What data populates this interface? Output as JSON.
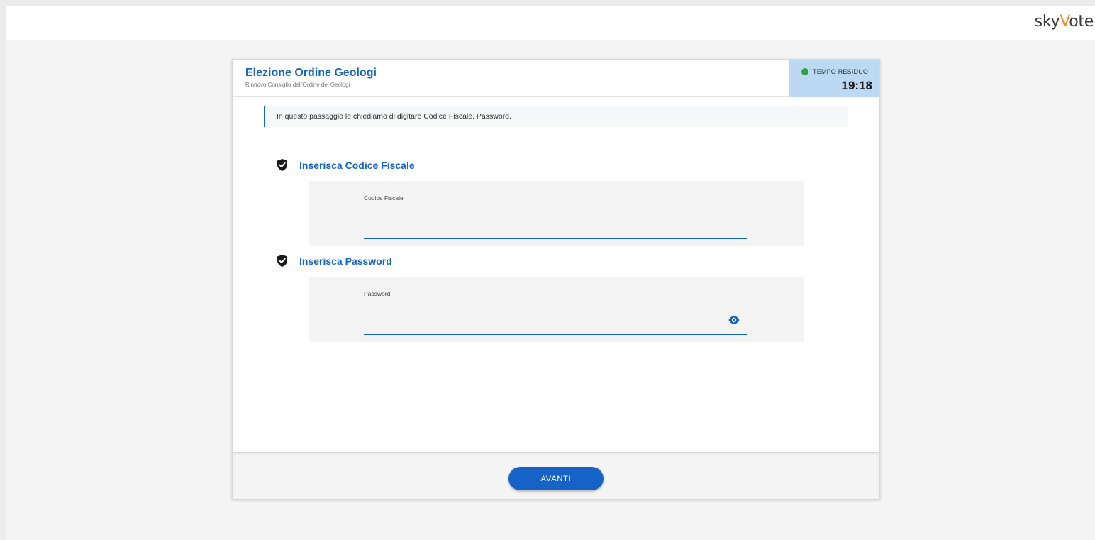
{
  "brand": {
    "part1": "sky",
    "part2": "V",
    "part3": "ote"
  },
  "header": {
    "title": "Elezione Ordine Geologi",
    "subtitle": "Rinnovo Consiglio dell'Ordine dei Geologi"
  },
  "timer": {
    "label": "TEMPO RESIDUO",
    "value": "19:18",
    "status_color": "#2ea043"
  },
  "info": {
    "text": "In questo passaggio le chiediamo di digitare Codice Fiscale, Password."
  },
  "sections": {
    "codice_fiscale": {
      "title": "Inserisca Codice Fiscale",
      "label": "Codice Fiscale",
      "value": "",
      "icon": "shield-check-icon"
    },
    "password": {
      "title": "Inserisca Password",
      "label": "Password",
      "value": "",
      "icon": "shield-check-icon",
      "toggle_icon": "eye-icon"
    }
  },
  "footer": {
    "button_label": "AVANTI"
  },
  "colors": {
    "accent": "#1465c0",
    "timer_bg": "#bcd9f3",
    "brand_v": "#f08a1c"
  }
}
